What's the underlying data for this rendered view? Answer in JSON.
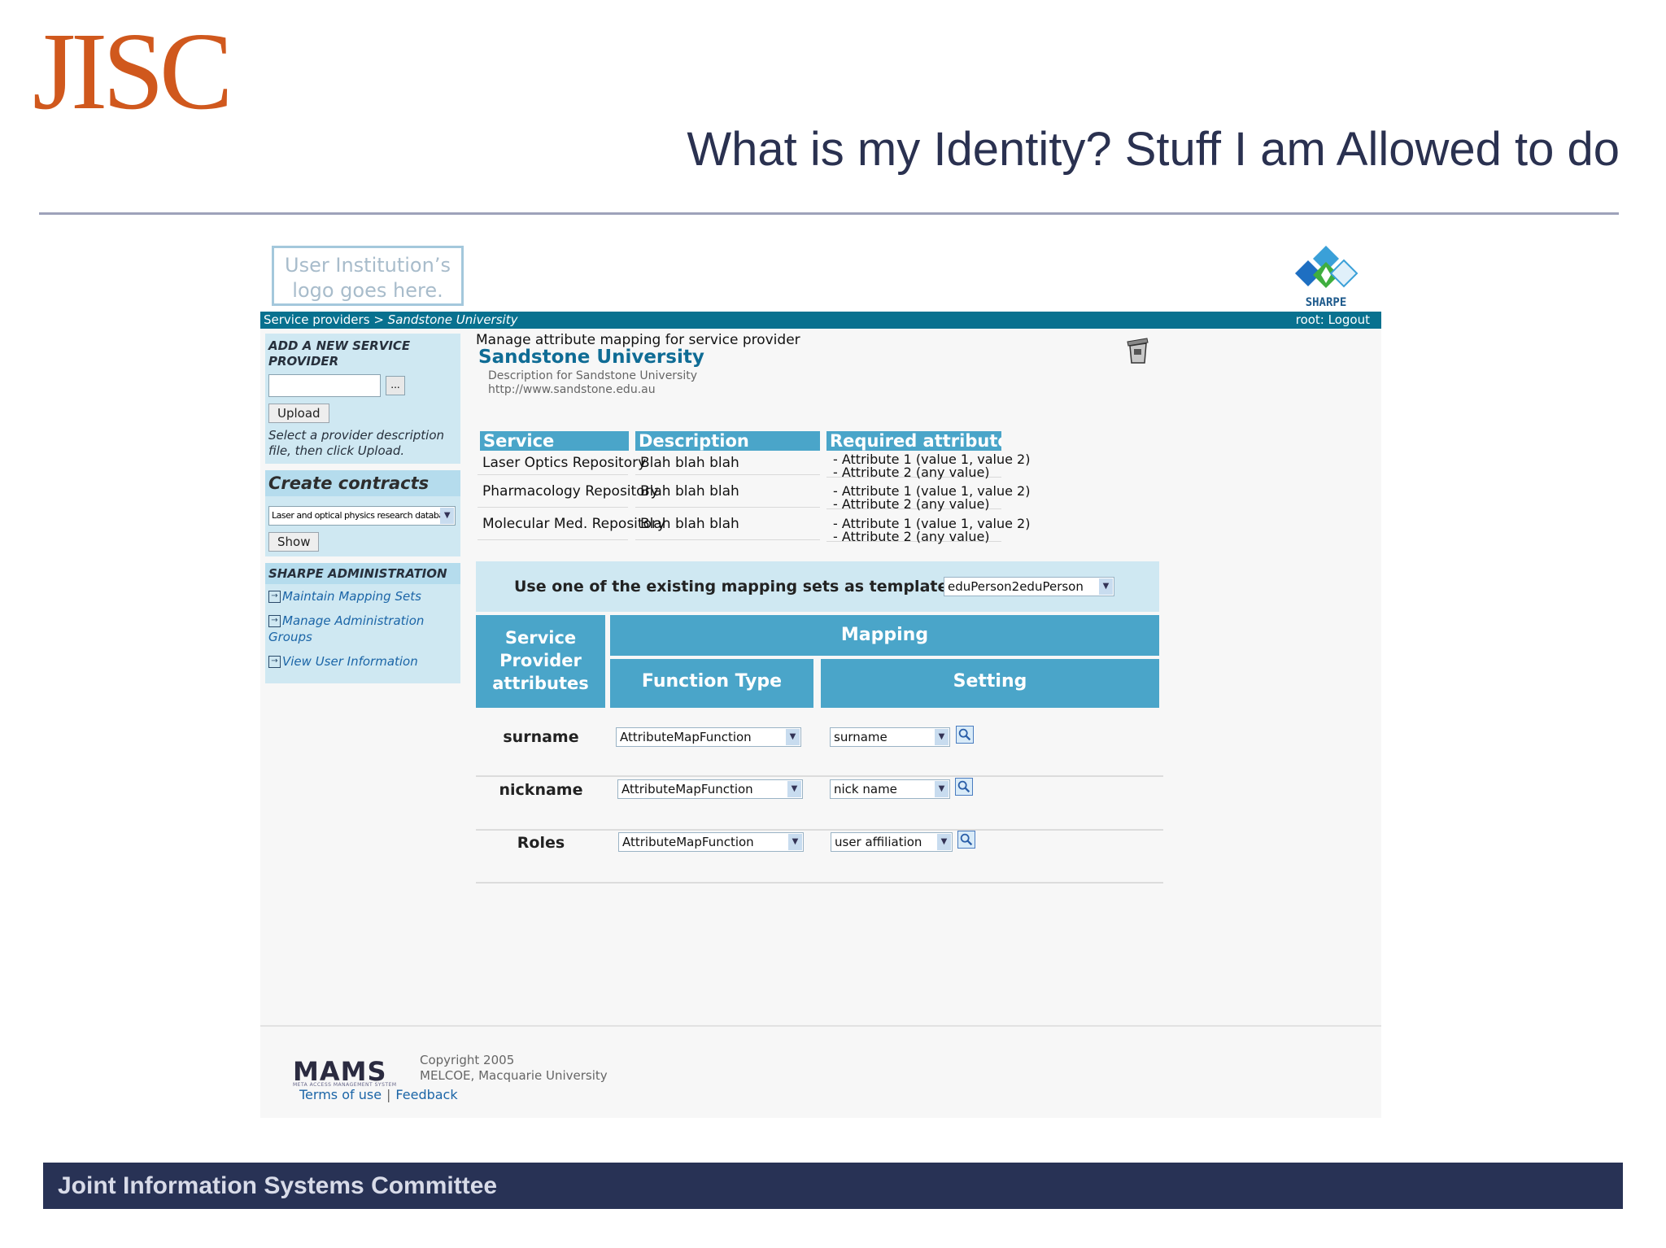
{
  "slide": {
    "logo_text": "JISC",
    "title": "What is my Identity? Stuff I am Allowed to do",
    "footer": "Joint Information Systems Committee"
  },
  "app": {
    "institution_logo_line1": "User Institution’s",
    "institution_logo_line2": "logo goes here.",
    "sharpe_label": "SHARPE",
    "breadcrumb": {
      "parent": "Service providers",
      "separator": ">",
      "current": "Sandstone University"
    },
    "session": "root: Logout",
    "sidebar": {
      "add_heading": "ADD A NEW SERVICE PROVIDER",
      "browse_label": "...",
      "upload_label": "Upload",
      "upload_hint": "Select a provider description file, then click Upload.",
      "contracts_heading": "Create contracts",
      "contract_selected": "Laser and optical physics research database (SJLOPR)",
      "show_label": "Show",
      "admin_heading": "SHARPE ADMINISTRATION",
      "links": [
        "Maintain Mapping Sets",
        "Manage Administration Groups",
        "View User Information"
      ]
    },
    "main": {
      "heading": "Manage attribute mapping for service provider",
      "provider_name": "Sandstone University",
      "provider_description": "Description for Sandstone University",
      "provider_url": "http://www.sandstone.edu.au",
      "services_headers": [
        "Service",
        "Description",
        "Required attributes"
      ],
      "services": [
        {
          "service": "Laser Optics Repository",
          "description": "Blah blah blah",
          "attributes": [
            "- Attribute 1 (value 1, value 2)",
            "- Attribute 2 (any value)"
          ]
        },
        {
          "service": "Pharmacology Repository",
          "description": "Blah blah blah",
          "attributes": [
            "- Attribute 1 (value 1, value 2)",
            "- Attribute 2 (any value)"
          ]
        },
        {
          "service": "Molecular Med. Repository",
          "description": "Blah blah blah",
          "attributes": [
            "- Attribute 1 (value 1, value 2)",
            "- Attribute 2 (any value)"
          ]
        }
      ],
      "template_label": "Use one of the existing mapping sets as template:",
      "template_selected": "eduPerson2eduPerson",
      "mapping_headers": {
        "sp_attributes": [
          "Service",
          "Provider",
          "attributes"
        ],
        "mapping": "Mapping",
        "function_type": "Function Type",
        "setting": "Setting"
      },
      "mappings": [
        {
          "attribute": "surname",
          "function": "AttributeMapFunction",
          "setting": "surname"
        },
        {
          "attribute": "nickname",
          "function": "AttributeMapFunction",
          "setting": "nick name"
        },
        {
          "attribute": "Roles",
          "function": "AttributeMapFunction",
          "setting": "user affiliation"
        }
      ]
    },
    "footer": {
      "brand": "MAMS",
      "brand_tagline": "META ACCESS MANAGEMENT SYSTEM",
      "copyright": "Copyright 2005",
      "org": "MELCOE, Macquarie University",
      "terms": "Terms of use",
      "sep": "|",
      "feedback": "Feedback"
    }
  },
  "icons": {
    "dropdown": "chevron-down-icon",
    "search": "magnifier-icon",
    "link": "arrow-in-box-icon",
    "trash": "trash-can-icon"
  },
  "colors": {
    "jisc_orange": "#d0581d",
    "title_navy": "#2a3150",
    "footer_navy": "#283255",
    "teal_bar": "#08718f",
    "header_blue": "#4aa5c9",
    "panel_blue": "#cfe8f2",
    "link_blue": "#1b65a7"
  }
}
